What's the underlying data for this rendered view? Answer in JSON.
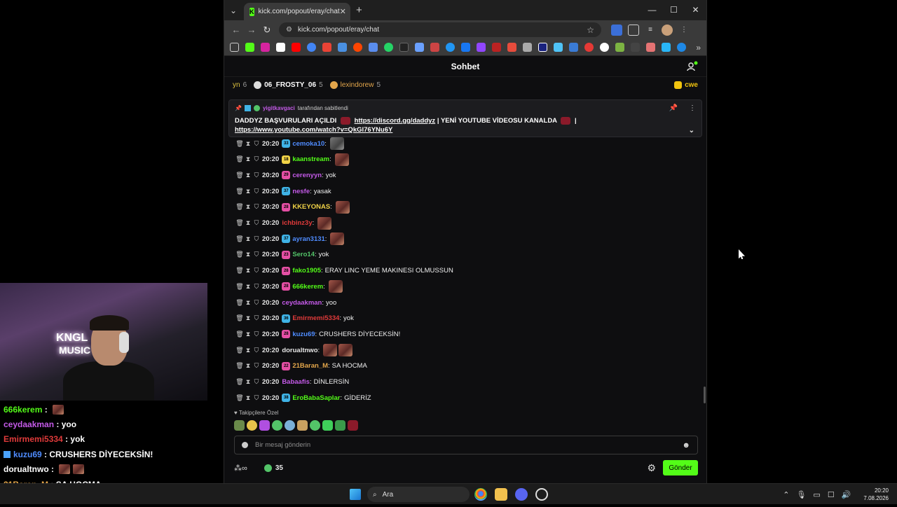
{
  "browser": {
    "tab_title": "kick.com/popout/eray/chat",
    "url": "kick.com/popout/eray/chat"
  },
  "chat": {
    "title": "Sohbet",
    "gifters": [
      {
        "name": "yn",
        "count": "6",
        "color": "#e0c440"
      },
      {
        "name": "06_FROSTY_06",
        "count": "5",
        "color": "#ffffff"
      },
      {
        "name": "lexindorew",
        "count": "5",
        "color": "#e3a64b"
      }
    ],
    "gifter_right": "cwe",
    "pinned": {
      "pinned_by_user": "yigitkavgaci",
      "pinned_by_suffix": "tarafından sabitlendi",
      "text_1": "DADDYZ BAŞVURULARI AÇILDI",
      "link_1": "https://discord.gg/daddyz",
      "text_2": "| YENİ YOUTUBE VİDEOSU KANALDA",
      "text_3": "|",
      "link_2": "https://www.youtube.com/watch?v=QkGl76YNu6Y"
    },
    "messages": [
      {
        "time": "20:20",
        "badge": "33",
        "badge_color": "#3fb3e6",
        "user": "cemoka10",
        "user_color": "#4f8cff",
        "text": "",
        "emotes": 1,
        "grey": true
      },
      {
        "time": "20:20",
        "badge": "18",
        "badge_color": "#f1d347",
        "user": "kaanstream",
        "user_color": "#53fc18",
        "text": "",
        "emotes": 1
      },
      {
        "time": "20:20",
        "badge": "29",
        "badge_color": "#e44fa4",
        "user": "cerenyyn",
        "user_color": "#c45ae8",
        "text": "yok",
        "emotes": 0
      },
      {
        "time": "20:20",
        "badge": "37",
        "badge_color": "#3fb3e6",
        "user": "nesfe",
        "user_color": "#c45ae8",
        "text": "yasak",
        "emotes": 0
      },
      {
        "time": "20:20",
        "badge": "28",
        "badge_color": "#e44fa4",
        "user": "KKEYONAS",
        "user_color": "#f1d347",
        "text": "",
        "emotes": 1
      },
      {
        "time": "20:20",
        "badge": "",
        "badge_color": "",
        "user": "ichbinz3y",
        "user_color": "#e03a3a",
        "text": "",
        "emotes": 1
      },
      {
        "time": "20:20",
        "badge": "37",
        "badge_color": "#3fb3e6",
        "user": "ayran3131",
        "user_color": "#4f8cff",
        "text": "",
        "emotes": 1
      },
      {
        "time": "20:20",
        "badge": "23",
        "badge_color": "#e44fa4",
        "user": "Sero14",
        "user_color": "#53c468",
        "text": "yok",
        "emotes": 0
      },
      {
        "time": "20:20",
        "badge": "28",
        "badge_color": "#e44fa4",
        "user": "fako1905",
        "user_color": "#53fc18",
        "text": "ERAY LINC YEME MAKINESI OLMUSSUN",
        "emotes": 0
      },
      {
        "time": "20:20",
        "badge": "28",
        "badge_color": "#e44fa4",
        "user": "666kerem",
        "user_color": "#53fc18",
        "text": "",
        "emotes": 1
      },
      {
        "time": "20:20",
        "badge": "",
        "badge_color": "",
        "user": "ceydaakman",
        "user_color": "#c45ae8",
        "text": "yoo",
        "emotes": 0
      },
      {
        "time": "20:20",
        "badge": "36",
        "badge_color": "#3fb3e6",
        "user": "Emirmemi5334",
        "user_color": "#e03a3a",
        "text": "yok",
        "emotes": 0
      },
      {
        "time": "20:20",
        "badge": "28",
        "badge_color": "#e44fa4",
        "user": "kuzu69",
        "user_color": "#4f8cff",
        "text": "CRUSHERS DİYECEKSİN!",
        "emotes": 0
      },
      {
        "time": "20:20",
        "badge": "",
        "badge_color": "",
        "user": "dorualtnwo",
        "user_color": "#e6e6e6",
        "text": "",
        "emotes": 2
      },
      {
        "time": "20:20",
        "badge": "22",
        "badge_color": "#e44fa4",
        "user": "21Baran_M",
        "user_color": "#e3a64b",
        "text": "SA HOCMA",
        "emotes": 0
      },
      {
        "time": "20:20",
        "badge": "",
        "badge_color": "",
        "user": "Babaafis",
        "user_color": "#c45ae8",
        "text": "DİNLERSİN",
        "emotes": 0
      },
      {
        "time": "20:20",
        "badge": "38",
        "badge_color": "#3fb3e6",
        "user": "EroBabaSaplar",
        "user_color": "#53fc18",
        "text": "GİDERİZ",
        "emotes": 0
      }
    ],
    "follower_section": "Takipçilere Özel",
    "input_placeholder": "Bir mesaj gönderin",
    "points": "35",
    "send_label": "Gönder"
  },
  "overlay_chat": [
    {
      "user": "666kerem",
      "color": "#53fc18",
      "text": "",
      "emote": true
    },
    {
      "user": "ceydaakman",
      "color": "#c45ae8",
      "text": "yoo",
      "emote": false
    },
    {
      "user": "Emirmemi5334",
      "color": "#e03a3a",
      "text": "yok",
      "emote": false
    },
    {
      "user": "kuzu69",
      "color": "#4f8cff",
      "text": "CRUSHERS DİYECEKSİN!",
      "emote": false,
      "cube": true
    },
    {
      "user": "dorualtnwo",
      "color": "#ffffff",
      "text": "",
      "emote": true,
      "double": true
    },
    {
      "user": "21Baran_M",
      "color": "#e3a64b",
      "text": "SA HOCMA",
      "emote": false
    },
    {
      "user": "Babaafis",
      "color": "#c45ae8",
      "text": "DİNLERSİN",
      "emote": false
    }
  ],
  "webcam": {
    "sign_line1": "KNGL",
    "sign_line2": "MUSIC"
  },
  "taskbar": {
    "search": "Ara",
    "time": "20:20",
    "date": "7.08.2026"
  },
  "colors": {
    "accent": "#53fc18",
    "background": "#0e0e10"
  }
}
